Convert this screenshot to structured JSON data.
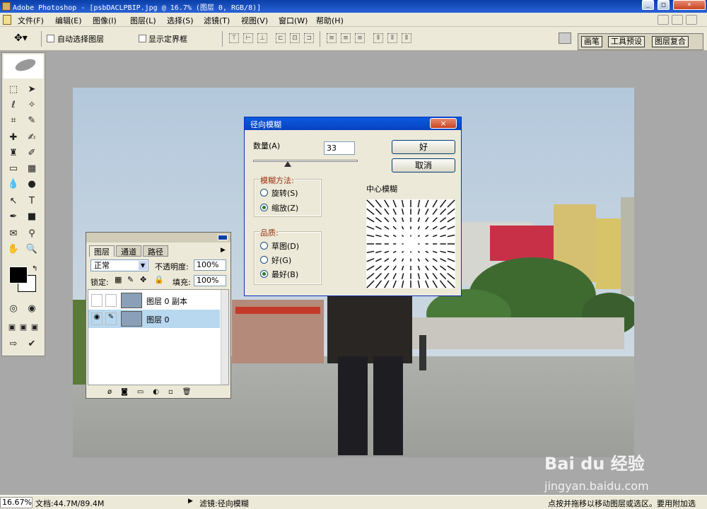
{
  "window": {
    "title": "Adobe Photoshop - [psbDACLPBIP.jpg @ 16.7% (图层 0, RGB/8)]",
    "min": "_",
    "max": "□",
    "close": "×"
  },
  "menu": [
    "文件(F)",
    "编辑(E)",
    "图像(I)",
    "图层(L)",
    "选择(S)",
    "滤镜(T)",
    "视图(V)",
    "窗口(W)",
    "帮助(H)"
  ],
  "options": {
    "auto_select": "自动选择图层",
    "show_bounds": "显示定界框",
    "tabs": [
      "画笔",
      "工具预设",
      "图层复合"
    ]
  },
  "layers_panel": {
    "tabs": [
      "图层",
      "通道",
      "路径"
    ],
    "blend_mode": "正常",
    "opacity_label": "不透明度:",
    "opacity": "100%",
    "lock_label": "锁定:",
    "fill_label": "填充:",
    "fill": "100%",
    "layers": [
      {
        "name": "图层 0 副本",
        "visible": false
      },
      {
        "name": "图层 0",
        "visible": true,
        "selected": true
      }
    ]
  },
  "dialog": {
    "title": "径向模糊",
    "amount_label": "数量(A)",
    "amount": "33",
    "amount_fraction": 0.33,
    "ok": "好",
    "cancel": "取消",
    "method_title": "模糊方法:",
    "method_spin": "旋转(S)",
    "method_zoom": "缩放(Z)",
    "method_selected": "zoom",
    "quality_title": "品质:",
    "q_draft": "草图(D)",
    "q_good": "好(G)",
    "q_best": "最好(B)",
    "quality_selected": "best",
    "center_label": "中心模糊"
  },
  "status": {
    "zoom": "16.67%",
    "doc": "文档:44.7M/89.4M",
    "filter": "滤镜:径向模糊",
    "hint": "点按并拖移以移动图层或选区。要用附加选"
  },
  "watermark": {
    "brand": "Bai du 经验",
    "url": "jingyan.baidu.com"
  }
}
